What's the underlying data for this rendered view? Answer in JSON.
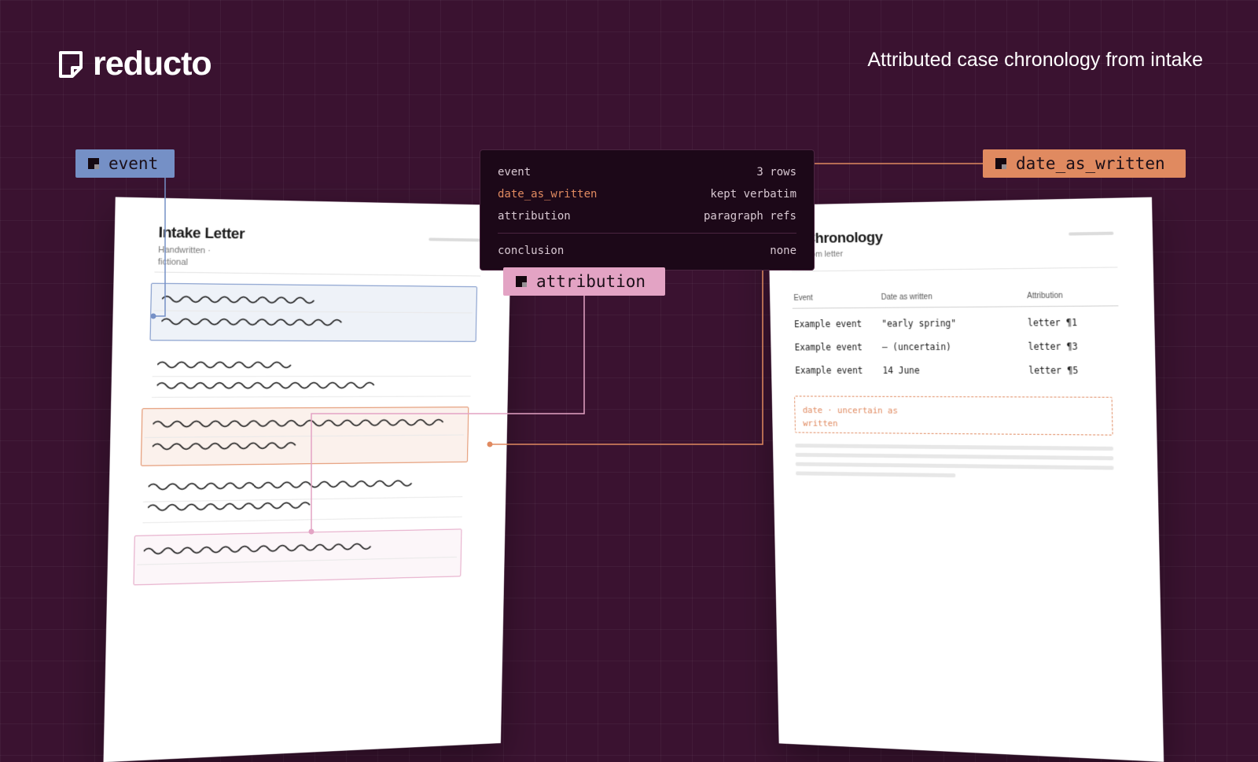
{
  "brand": {
    "name": "reducto",
    "icon": "reducto-logo-icon"
  },
  "header": {
    "title": "Attributed case chronology from intake"
  },
  "labels": {
    "event": "event",
    "date_as_written": "date_as_written",
    "attribution": "attribution"
  },
  "schema": {
    "rows": [
      {
        "key": "event",
        "value": "3 rows"
      },
      {
        "key": "date_as_written",
        "value": "kept verbatim"
      },
      {
        "key": "attribution",
        "value": "paragraph refs"
      }
    ],
    "footer": {
      "key": "conclusion",
      "value": "none"
    }
  },
  "left_doc": {
    "title": "Intake Letter",
    "subtitle_line1": "Handwritten ·",
    "subtitle_line2": "fictional"
  },
  "right_doc": {
    "title": "e Chronology",
    "subtitle": "ed from letter",
    "columns": [
      "Event",
      "Date as written",
      "Attribution"
    ],
    "rows": [
      {
        "event": "Example event",
        "date": "\"early spring\"",
        "attribution": "letter ¶1"
      },
      {
        "event": "Example event",
        "date": "— (uncertain)",
        "attribution": "letter ¶3"
      },
      {
        "event": "Example event",
        "date": "14 June",
        "attribution": "letter ¶5"
      }
    ],
    "note_line1": "date · uncertain as",
    "note_line2": "written"
  },
  "colors": {
    "background": "#3a1230",
    "event": "#7590c6",
    "date_as_written": "#e08a60",
    "attribution": "#e3a3c4",
    "panel": "#1c0818"
  }
}
